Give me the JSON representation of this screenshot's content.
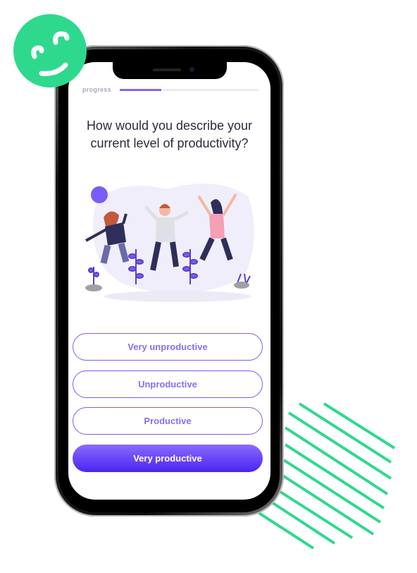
{
  "progress": {
    "label": "progress",
    "value_percent": 30
  },
  "question": "How would you describe your current level of productivity?",
  "options": [
    {
      "label": "Very unproductive",
      "selected": false
    },
    {
      "label": "Unproductive",
      "selected": false
    },
    {
      "label": "Productive",
      "selected": false
    },
    {
      "label": "Very productive",
      "selected": true
    }
  ],
  "colors": {
    "accent": "#7a5cf6",
    "brand_green": "#2ed98e",
    "selected_gradient": [
      "#8a6bff",
      "#4a24f0"
    ]
  },
  "icons": {
    "logo": "smiley-face-icon"
  }
}
